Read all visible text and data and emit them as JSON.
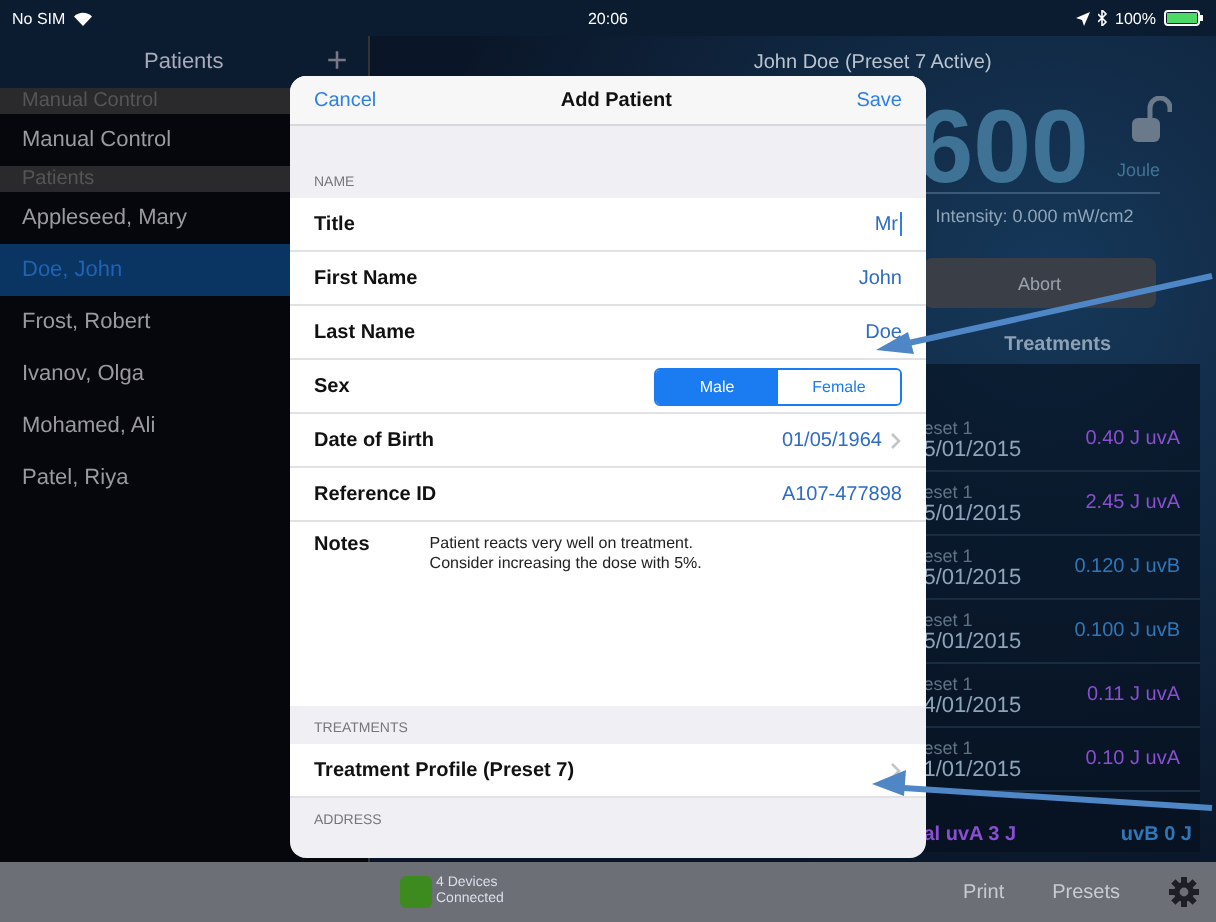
{
  "status_bar": {
    "carrier": "No SIM",
    "time": "20:06",
    "battery": "100%"
  },
  "sidebar": {
    "title": "Patients",
    "add_button": "+",
    "sections": [
      {
        "header": "Manual Control",
        "items": [
          {
            "label": "Manual Control",
            "selected": false
          }
        ]
      },
      {
        "header": "Patients",
        "items": [
          {
            "label": "Appleseed, Mary",
            "selected": false
          },
          {
            "label": "Doe, John",
            "selected": true
          },
          {
            "label": "Frost, Robert",
            "selected": false
          },
          {
            "label": "Ivanov, Olga",
            "selected": false
          },
          {
            "label": "Mohamed, Ali",
            "selected": false
          },
          {
            "label": "Patel, Riya",
            "selected": false
          }
        ]
      }
    ]
  },
  "detail": {
    "title": "John Doe (Preset 7 Active)",
    "energy": "600",
    "unit": "Joule",
    "intensity": "Intensity: 0.000 mW/cm2",
    "abort_button": "Abort",
    "treatments_title": "Treatments",
    "treatments": [
      {
        "preset": "eset 1",
        "date": "5/01/2015",
        "dose": "0.40 J uvA",
        "color": "#8a4fd0"
      },
      {
        "preset": "eset 1",
        "date": "5/01/2015",
        "dose": "2.45 J uvA",
        "color": "#8a4fd0"
      },
      {
        "preset": "eset 1",
        "date": "5/01/2015",
        "dose": "0.120 J uvB",
        "color": "#2f77b8"
      },
      {
        "preset": "eset 1",
        "date": "5/01/2015",
        "dose": "0.100 J uvB",
        "color": "#2f77b8"
      },
      {
        "preset": "eset 1",
        "date": "4/01/2015",
        "dose": "0.11 J uvA",
        "color": "#8a4fd0"
      },
      {
        "preset": "eset 1",
        "date": "1/01/2015",
        "dose": "0.10 J uvA",
        "color": "#8a4fd0"
      }
    ],
    "totals": [
      {
        "label": "al uvA 3 J",
        "color": "#8a4fd0"
      },
      {
        "label": "uvB 0 J",
        "color": "#2f77b8"
      }
    ]
  },
  "toolbar": {
    "devices": "4 Devices\nConnected",
    "buttons": [
      "Print",
      "Presets"
    ]
  },
  "dialog": {
    "cancel": "Cancel",
    "title": "Add Patient",
    "save": "Save",
    "sections": [
      {
        "header": "NAME",
        "rows": [
          {
            "kind": "text",
            "label": "Title",
            "value": "Mr",
            "focused": true
          },
          {
            "kind": "text",
            "label": "First Name",
            "value": "John",
            "focused": false
          },
          {
            "kind": "text",
            "label": "Last Name",
            "value": "Doe",
            "focused": false
          },
          {
            "kind": "segmented",
            "label": "Sex",
            "options": [
              {
                "label": "Male",
                "selected": true
              },
              {
                "label": "Female",
                "selected": false
              }
            ]
          },
          {
            "kind": "disclosure",
            "label": "Date of Birth",
            "value": "01/05/1964"
          },
          {
            "kind": "text",
            "label": "Reference ID",
            "value": "A107-477898",
            "focused": false
          },
          {
            "kind": "notes",
            "label": "Notes",
            "value": "Patient reacts very well on treatment.\nConsider increasing the dose with 5%."
          }
        ]
      },
      {
        "header": "TREATMENTS",
        "rows": [
          {
            "kind": "disclosure",
            "label": "Treatment Profile (Preset 7)"
          }
        ]
      },
      {
        "header": "ADDRESS"
      }
    ]
  }
}
